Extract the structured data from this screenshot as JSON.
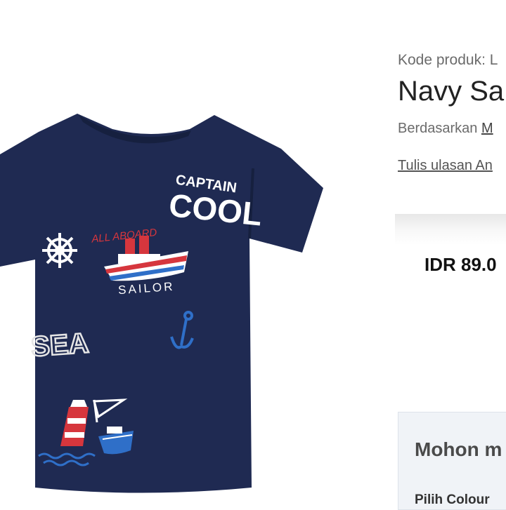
{
  "product": {
    "code_text": "Kode produk: L",
    "title": "Navy Sa",
    "rating_prefix": "Berdasarkan",
    "rating_link": "M",
    "write_review": "Tulis ulasan An",
    "price": "IDR 89.0",
    "image": {
      "print_texts": {
        "captain": "CAPTAIN",
        "cool": "COOL",
        "all_aboard": "ALL ABOARD",
        "sailor": "SAILOR",
        "sea": "SEA"
      },
      "colors": {
        "shirt": "#1f2a52",
        "shirt_shadow": "#16203f",
        "red": "#d6363d",
        "blue": "#2f6fc8",
        "white": "#ffffff"
      }
    }
  },
  "notice": {
    "title": "Mohon m",
    "colour_label": "Pilih Colour"
  }
}
